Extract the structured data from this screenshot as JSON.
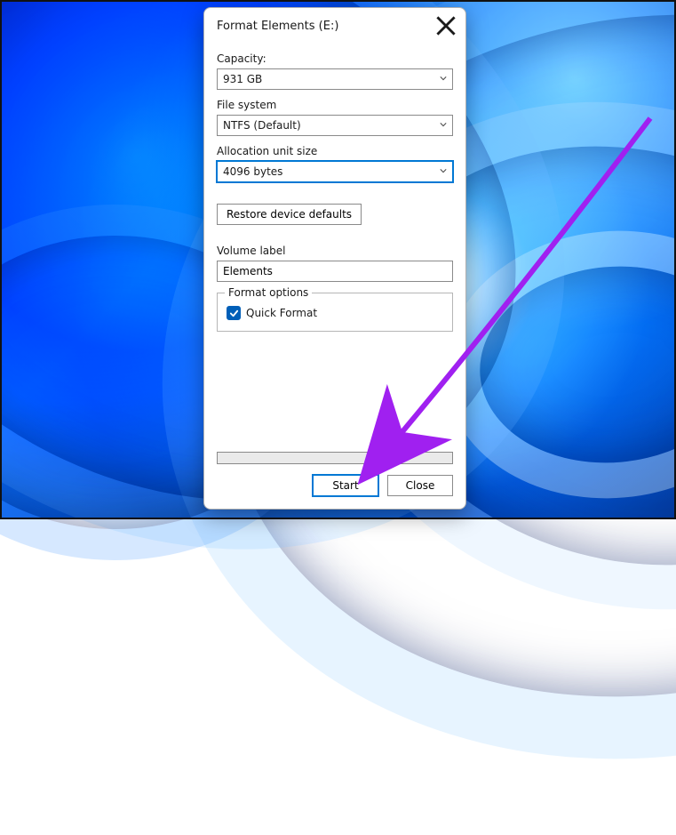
{
  "dialog": {
    "title": "Format Elements (E:)",
    "capacity_label": "Capacity:",
    "capacity_value": "931 GB",
    "filesystem_label": "File system",
    "filesystem_value": "NTFS (Default)",
    "alloc_label": "Allocation unit size",
    "alloc_value": "4096 bytes",
    "restore_label": "Restore device defaults",
    "volume_label_label": "Volume label",
    "volume_label_value": "Elements",
    "format_options_legend": "Format options",
    "quick_format_label": "Quick Format",
    "quick_format_checked": true,
    "start_label": "Start",
    "close_label": "Close"
  }
}
